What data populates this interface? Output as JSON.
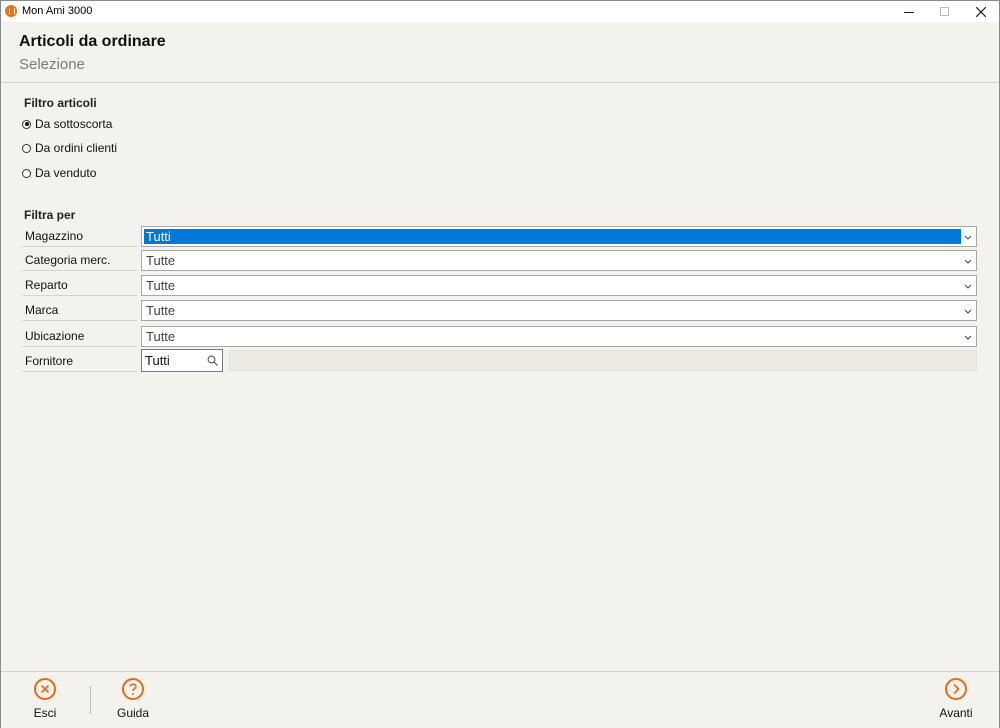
{
  "window": {
    "title": "Mon Ami 3000"
  },
  "header": {
    "title": "Articoli da ordinare",
    "subtitle": "Selezione"
  },
  "filtro_articoli": {
    "heading": "Filtro articoli",
    "options": [
      {
        "label": "Da sottoscorta",
        "selected": true
      },
      {
        "label": "Da ordini clienti",
        "selected": false
      },
      {
        "label": "Da venduto",
        "selected": false
      }
    ]
  },
  "filtra_per": {
    "heading": "Filtra per",
    "fields": [
      {
        "label": "Magazzino",
        "value": "Tutti"
      },
      {
        "label": "Categoria merc.",
        "value": "Tutte"
      },
      {
        "label": "Reparto",
        "value": "Tutte"
      },
      {
        "label": "Marca",
        "value": "Tutte"
      },
      {
        "label": "Ubicazione",
        "value": "Tutte"
      }
    ],
    "fornitore": {
      "label": "Fornitore",
      "value": "Tutti",
      "description": ""
    }
  },
  "footer": {
    "esci": "Esci",
    "guida": "Guida",
    "avanti": "Avanti"
  },
  "colors": {
    "accent": "#e36c1a",
    "selection": "#0078d7"
  },
  "icons": {
    "esci": "close-circle-icon",
    "guida": "help-circle-icon",
    "avanti": "arrow-right-circle-icon",
    "search": "search-icon"
  }
}
